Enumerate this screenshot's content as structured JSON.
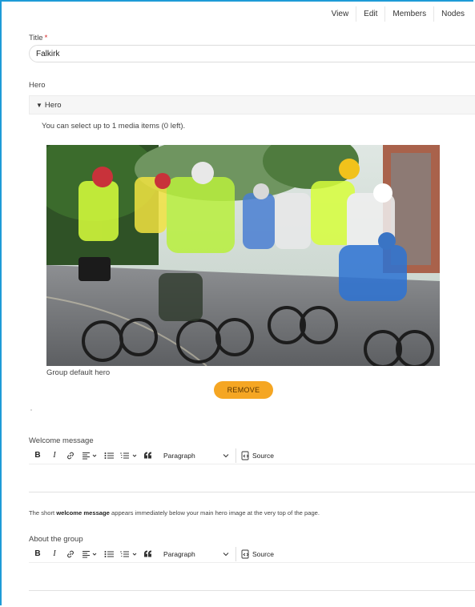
{
  "tabs": [
    "View",
    "Edit",
    "Members",
    "Nodes"
  ],
  "title_field": {
    "label": "Title",
    "required_mark": "*",
    "value": "Falkirk"
  },
  "hero": {
    "label": "Hero",
    "summary": "Hero",
    "hint": "You can select up to 1 media items (0 left).",
    "caption": "Group default hero",
    "remove_label": "REMOVE",
    "remove_color": "#f5a623"
  },
  "toolbar": {
    "paragraph": "Paragraph",
    "source": "Source"
  },
  "welcome": {
    "label": "Welcome message",
    "help_pre": "The short ",
    "help_bold": "welcome message",
    "help_post": " appears immediately below your main hero image at the very top of the page."
  },
  "about": {
    "label": "About the group"
  },
  "colors": {
    "frame": "#1e9bd7",
    "required": "#d21f1f"
  }
}
